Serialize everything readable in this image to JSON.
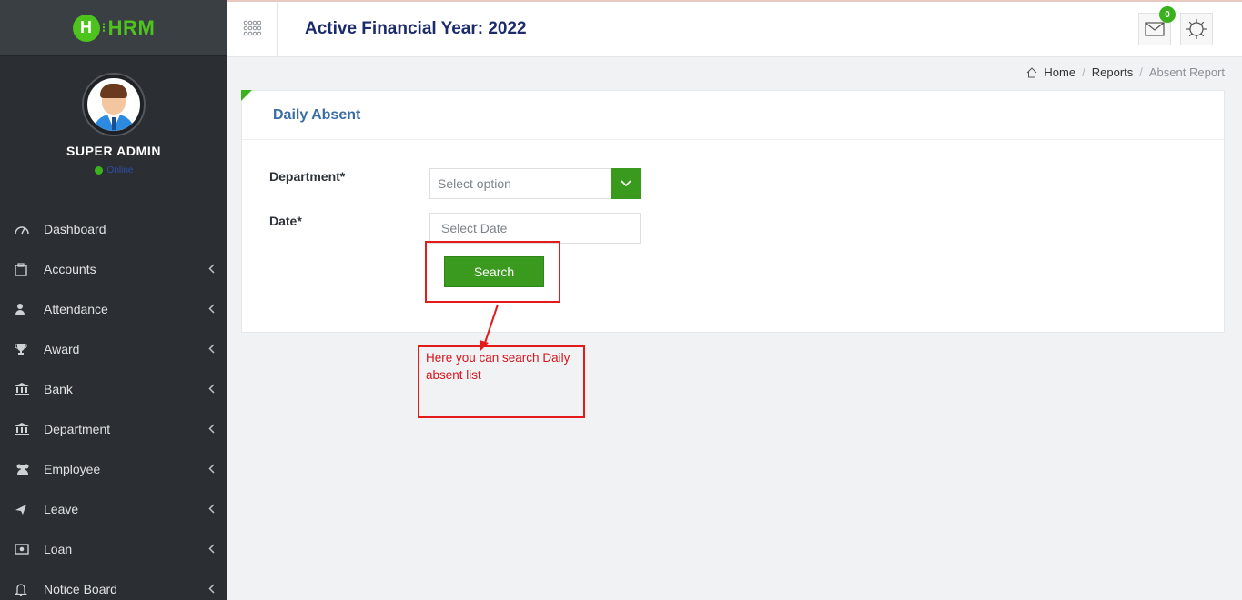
{
  "app": {
    "logo_text": "HRM",
    "logo_letter": "H"
  },
  "profile": {
    "name": "SUPER ADMIN",
    "status": "Online"
  },
  "sidebar": {
    "items": [
      {
        "label": "Dashboard",
        "icon": "dashboard-icon",
        "expandable": false
      },
      {
        "label": "Accounts",
        "icon": "accounts-icon",
        "expandable": true
      },
      {
        "label": "Attendance",
        "icon": "user-icon",
        "expandable": true
      },
      {
        "label": "Award",
        "icon": "trophy-icon",
        "expandable": true
      },
      {
        "label": "Bank",
        "icon": "bank-icon",
        "expandable": true
      },
      {
        "label": "Department",
        "icon": "bank-icon",
        "expandable": true
      },
      {
        "label": "Employee",
        "icon": "users-icon",
        "expandable": true
      },
      {
        "label": "Leave",
        "icon": "plane-icon",
        "expandable": true
      },
      {
        "label": "Loan",
        "icon": "money-icon",
        "expandable": true
      },
      {
        "label": "Notice Board",
        "icon": "bell-icon",
        "expandable": true
      }
    ]
  },
  "header": {
    "title": "Active Financial Year: 2022",
    "mail_count": "0"
  },
  "breadcrumb": {
    "home": "Home",
    "reports": "Reports",
    "current": "Absent Report"
  },
  "card": {
    "title": "Daily Absent",
    "department_label": "Department*",
    "department_placeholder": "Select option",
    "date_label": "Date*",
    "date_placeholder": "Select Date",
    "search_label": "Search"
  },
  "annotation": {
    "text": "Here you can search Daily absent list"
  },
  "colors": {
    "accent": "#3a9a1e",
    "sidebar": "#2b2f33",
    "title": "#1c2a6e",
    "annotation": "#e31b1b"
  }
}
